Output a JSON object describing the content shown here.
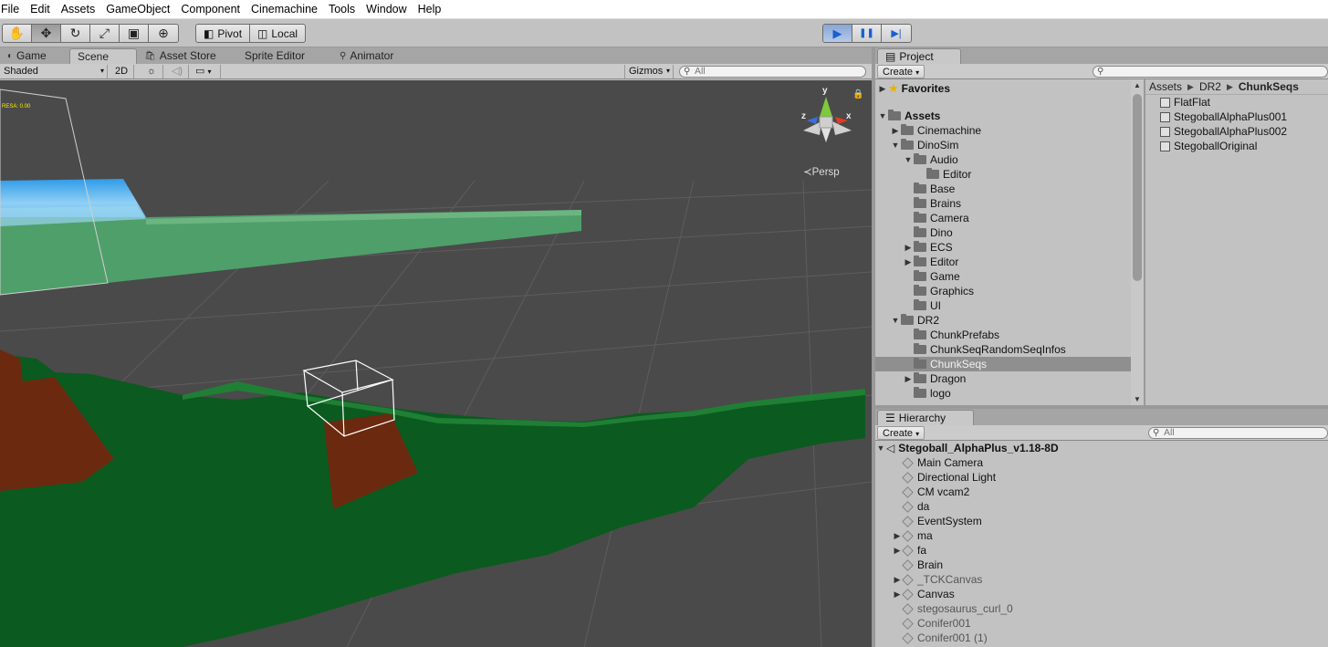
{
  "menu": [
    "File",
    "Edit",
    "Assets",
    "GameObject",
    "Component",
    "Cinemachine",
    "Tools",
    "Window",
    "Help"
  ],
  "toolbar": {
    "transform_tools": [
      {
        "name": "hand-tool",
        "glyph": "✋"
      },
      {
        "name": "move-tool",
        "glyph": "✥"
      },
      {
        "name": "rotate-tool",
        "glyph": "↻"
      },
      {
        "name": "scale-tool",
        "glyph": "⤢"
      },
      {
        "name": "rect-tool",
        "glyph": "▣"
      },
      {
        "name": "transform-tool",
        "glyph": "⊕"
      }
    ],
    "pivot_label": "Pivot",
    "local_label": "Local",
    "play_glyph": "▶",
    "pause_glyph": "❚❚",
    "step_glyph": "▶|"
  },
  "scene_tabs": [
    {
      "label": "Game",
      "glyph": "◐"
    },
    {
      "label": "Scene",
      "glyph": ""
    },
    {
      "label": "Asset Store",
      "glyph": "🛍"
    },
    {
      "label": "Sprite Editor",
      "glyph": ""
    },
    {
      "label": "Animator",
      "glyph": "⚲"
    }
  ],
  "scene_bar": {
    "shading": "Shaded",
    "mode_2d": "2D",
    "gizmos": "Gizmos",
    "search_placeholder": "All"
  },
  "scene": {
    "persp_label": "Persp",
    "axis_y": "y",
    "axis_x": "x",
    "axis_z": "z",
    "overlay_text": "RESA: 0.00"
  },
  "project": {
    "tab_label": "Project",
    "create_label": "Create",
    "search_placeholder": "",
    "tree": [
      {
        "label": "Favorites",
        "depth": 0,
        "expand": "right",
        "icon": "star",
        "bold": true
      },
      {
        "label": "Assets",
        "depth": 0,
        "expand": "down",
        "icon": "folder",
        "bold": true
      },
      {
        "label": "Cinemachine",
        "depth": 1,
        "expand": "right",
        "icon": "folder"
      },
      {
        "label": "DinoSim",
        "depth": 1,
        "expand": "down",
        "icon": "folder"
      },
      {
        "label": "Audio",
        "depth": 2,
        "expand": "down",
        "icon": "folder"
      },
      {
        "label": "Editor",
        "depth": 3,
        "expand": "",
        "icon": "folder"
      },
      {
        "label": "Base",
        "depth": 2,
        "expand": "",
        "icon": "folder"
      },
      {
        "label": "Brains",
        "depth": 2,
        "expand": "",
        "icon": "folder"
      },
      {
        "label": "Camera",
        "depth": 2,
        "expand": "",
        "icon": "folder"
      },
      {
        "label": "Dino",
        "depth": 2,
        "expand": "",
        "icon": "folder"
      },
      {
        "label": "ECS",
        "depth": 2,
        "expand": "right",
        "icon": "folder"
      },
      {
        "label": "Editor",
        "depth": 2,
        "expand": "right",
        "icon": "folder"
      },
      {
        "label": "Game",
        "depth": 2,
        "expand": "",
        "icon": "folder"
      },
      {
        "label": "Graphics",
        "depth": 2,
        "expand": "",
        "icon": "folder"
      },
      {
        "label": "UI",
        "depth": 2,
        "expand": "",
        "icon": "folder"
      },
      {
        "label": "DR2",
        "depth": 1,
        "expand": "down",
        "icon": "folder"
      },
      {
        "label": "ChunkPrefabs",
        "depth": 2,
        "expand": "",
        "icon": "folder"
      },
      {
        "label": "ChunkSeqRandomSeqInfos",
        "depth": 2,
        "expand": "",
        "icon": "folder"
      },
      {
        "label": "ChunkSeqs",
        "depth": 2,
        "expand": "",
        "icon": "folder",
        "selected": true
      },
      {
        "label": "Dragon",
        "depth": 2,
        "expand": "right",
        "icon": "folder"
      },
      {
        "label": "logo",
        "depth": 2,
        "expand": "",
        "icon": "folder"
      }
    ],
    "breadcrumb": [
      "Assets",
      "DR2",
      "ChunkSeqs"
    ],
    "assets": [
      "FlatFlat",
      "StegoballAlphaPlus001",
      "StegoballAlphaPlus002",
      "StegoballOriginal"
    ]
  },
  "hierarchy": {
    "tab_label": "Hierarchy",
    "create_label": "Create",
    "search_placeholder": "All",
    "scene_name": "Stegoball_AlphaPlus_v1.18-8D",
    "items": [
      {
        "label": "Main Camera",
        "expand": "",
        "dim": false
      },
      {
        "label": "Directional Light",
        "expand": "",
        "dim": false
      },
      {
        "label": "CM vcam2",
        "expand": "",
        "dim": false
      },
      {
        "label": "da",
        "expand": "",
        "dim": false
      },
      {
        "label": "EventSystem",
        "expand": "",
        "dim": false
      },
      {
        "label": "ma",
        "expand": "right",
        "dim": false
      },
      {
        "label": "fa",
        "expand": "right",
        "dim": false
      },
      {
        "label": "Brain",
        "expand": "",
        "dim": false
      },
      {
        "label": "_TCKCanvas",
        "expand": "right",
        "dim": true
      },
      {
        "label": "Canvas",
        "expand": "right",
        "dim": false
      },
      {
        "label": "stegosaurus_curl_0",
        "expand": "",
        "dim": true
      },
      {
        "label": "Conifer001",
        "expand": "",
        "dim": true
      },
      {
        "label": "Conifer001 (1)",
        "expand": "",
        "dim": true
      }
    ]
  }
}
